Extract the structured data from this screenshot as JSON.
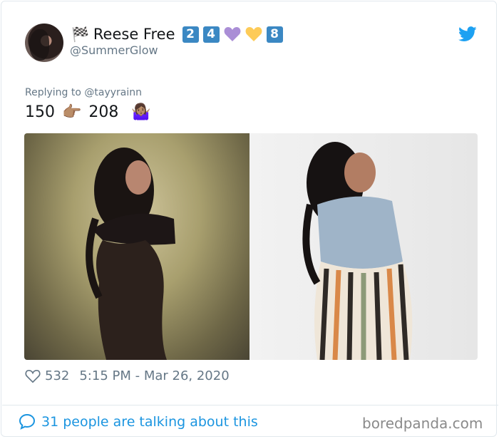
{
  "user": {
    "name": "Reese Free",
    "handle": "@SummerGlow",
    "flag_emoji": "🏁",
    "badges": [
      "2",
      "4",
      "💜",
      "💛",
      "8"
    ]
  },
  "tweet": {
    "replying_to": "Replying to @tayyrainn",
    "number_left": "150",
    "number_right": "208",
    "emoji_point": "👉🏽",
    "emoji_shrug": "🤷🏽‍♀️"
  },
  "stats": {
    "likes": "532",
    "timestamp": "5:15 PM - Mar 26, 2020"
  },
  "footer": {
    "conversation": "31 people are talking about this",
    "watermark": "boredpanda.com"
  },
  "colors": {
    "twitter_blue": "#1da1f2",
    "link_blue": "#1b95e0",
    "keycap_blue": "#3b88c3",
    "muted_text": "#657786"
  }
}
